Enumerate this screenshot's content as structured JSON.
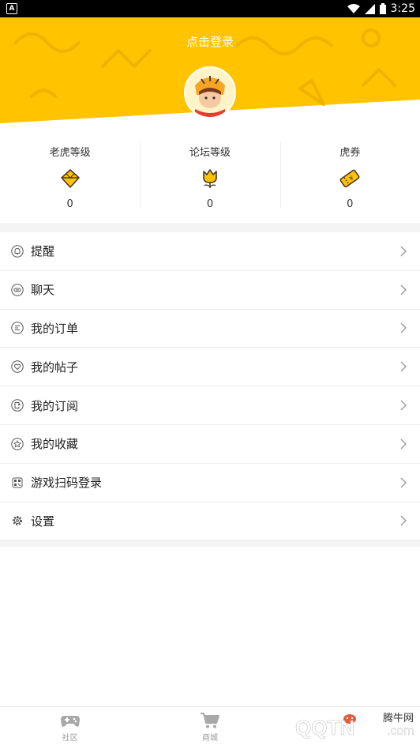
{
  "status_bar": {
    "time": "3:25",
    "left_badge": "A"
  },
  "header": {
    "login_text": "点击登录",
    "bg_color": "#FFC300"
  },
  "stats": [
    {
      "label": "老虎等级",
      "icon": "diamond-icon",
      "value": "0"
    },
    {
      "label": "论坛等级",
      "icon": "tulip-icon",
      "value": "0"
    },
    {
      "label": "虎券",
      "icon": "ticket-icon",
      "value": "0"
    }
  ],
  "menu": [
    {
      "label": "提醒",
      "icon": "bell-icon"
    },
    {
      "label": "聊天",
      "icon": "chat-icon"
    },
    {
      "label": "我的订单",
      "icon": "list-icon"
    },
    {
      "label": "我的帖子",
      "icon": "heart-icon"
    },
    {
      "label": "我的订阅",
      "icon": "subscribe-icon"
    },
    {
      "label": "我的收藏",
      "icon": "star-icon"
    },
    {
      "label": "游戏扫码登录",
      "icon": "qrcode-icon"
    },
    {
      "label": "设置",
      "icon": "gear-icon"
    }
  ],
  "tabbar": [
    {
      "label": "社区",
      "icon": "gamepad-icon"
    },
    {
      "label": "商城",
      "icon": "cart-icon"
    },
    {
      "label": "",
      "icon": "profile-icon"
    }
  ],
  "watermark": {
    "text": "腾牛网",
    "brand": "QQTN.com"
  }
}
